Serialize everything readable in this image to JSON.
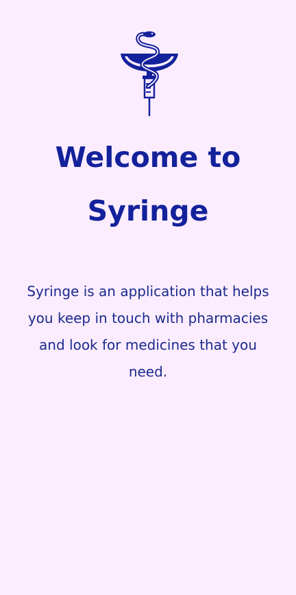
{
  "app": {
    "logo_icon": "bowl-of-hygieia-syringe-icon",
    "accent_color": "#13219b",
    "background_color": "#fcedfe"
  },
  "welcome": {
    "title_line1": "Welcome to",
    "title_line2": "Syringe",
    "description": "Syringe is an application that helps you keep in touch with pharmacies and look for medicines that you need."
  }
}
